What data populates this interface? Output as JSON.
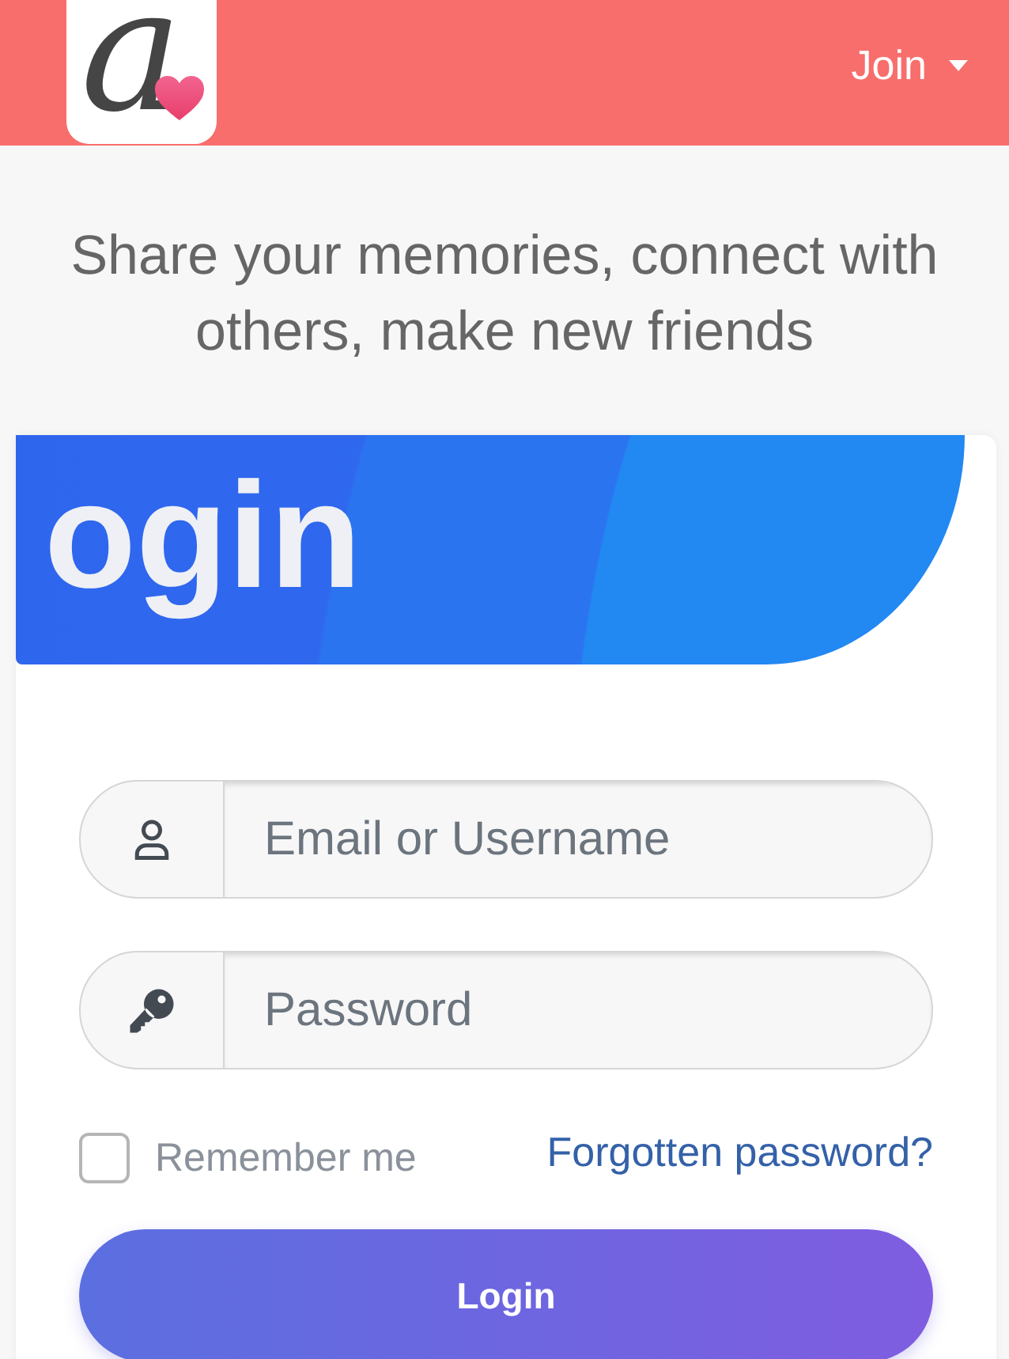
{
  "header": {
    "logo": {
      "letter": "a"
    },
    "join_menu": {
      "label": "Join"
    }
  },
  "hero": {
    "subtitle": "Share your memories, connect with others, make new friends"
  },
  "login_card": {
    "title": "ogin",
    "fields": [
      {
        "kind": "email",
        "placeholder": "Email or Username"
      },
      {
        "kind": "password",
        "placeholder": "Password"
      }
    ],
    "remember_me": {
      "label": "Remember me",
      "checked": false
    },
    "forgot_link": "Forgotten password?",
    "submit": "Login"
  }
}
